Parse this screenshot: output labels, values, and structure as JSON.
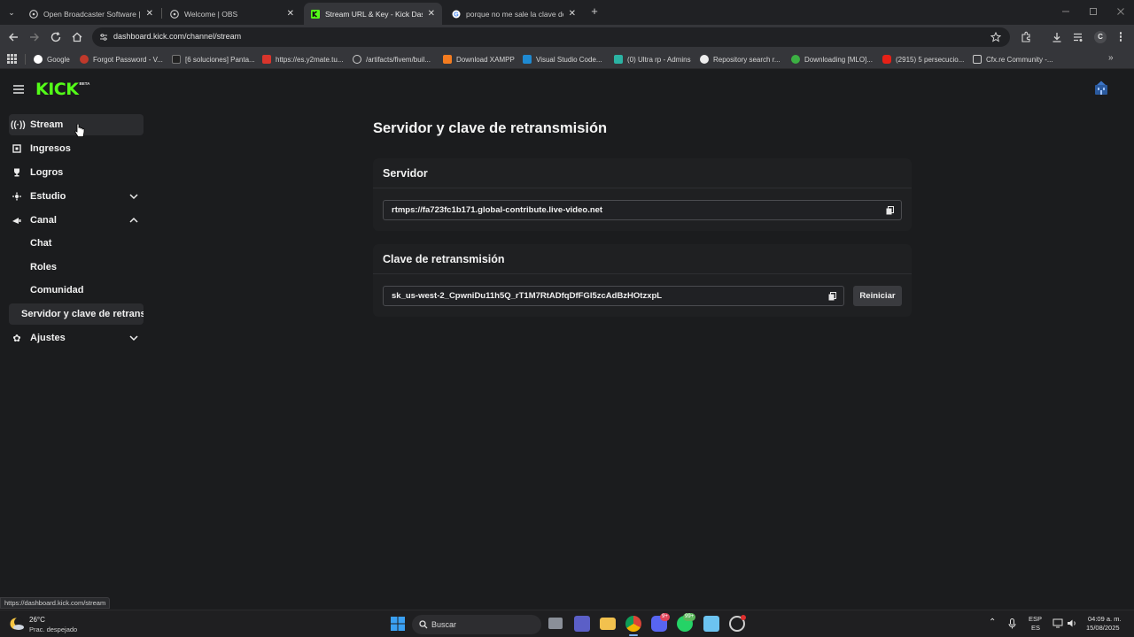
{
  "browser": {
    "tabs": [
      {
        "title": "Open Broadcaster Software | O",
        "active": false
      },
      {
        "title": "Welcome | OBS",
        "active": false
      },
      {
        "title": "Stream URL & Key - Kick Dashb",
        "active": true
      },
      {
        "title": "porque no me sale la clave de r",
        "active": false
      }
    ],
    "close_glyph": "✕",
    "new_tab_glyph": "+",
    "address": "dashboard.kick.com/channel/stream",
    "profile_initial": "C"
  },
  "bookmarks": [
    "Google",
    "Forgot Password - V...",
    "[6 soluciones] Panta...",
    "https://es.y2mate.tu...",
    "/artifacts/fivem/buil...",
    "Download XAMPP",
    "Visual Studio Code...",
    "(0) Ultra rp - Admins",
    "Repository search r...",
    "Downloading [MLO]...",
    "(2915) 5 persecucio...",
    "Cfx.re Community -..."
  ],
  "app": {
    "logo": "KICK",
    "logo_badge": "BETA"
  },
  "sidebar": {
    "items": [
      {
        "label": "Stream",
        "icon": "broadcast-icon"
      },
      {
        "label": "Ingresos",
        "icon": "revenue-icon"
      },
      {
        "label": "Logros",
        "icon": "trophy-icon"
      },
      {
        "label": "Estudio",
        "icon": "studio-icon"
      },
      {
        "label": "Canal",
        "icon": "channel-icon"
      },
      {
        "label": "Ajustes",
        "icon": "gear-icon"
      }
    ],
    "canal_sub": [
      "Chat",
      "Roles",
      "Comunidad",
      "Servidor y clave de retransmisión"
    ]
  },
  "main": {
    "title": "Servidor y clave de retransmisión",
    "server": {
      "heading": "Servidor",
      "value": "rtmps://fa723fc1b171.global-contribute.live-video.net"
    },
    "key": {
      "heading": "Clave de retransmisión",
      "value": "sk_us-west-2_CpwniDu11h5Q_rT1M7RtADfqDfFGI5zcAdBzHOtzxpL",
      "reset_label": "Reiniciar"
    }
  },
  "status_url": "https://dashboard.kick.com/stream",
  "taskbar": {
    "weather_temp": "26°C",
    "weather_desc": "Prac. despejado",
    "search_placeholder": "Buscar",
    "discord_badge": "9+",
    "whatsapp_badge": "99+",
    "lang_top": "ESP",
    "lang_bottom": "ES",
    "time": "04:09 a. m.",
    "date": "15/08/2025"
  },
  "colors": {
    "kick_green": "#53fc18",
    "page_bg": "#1b1c1e"
  }
}
